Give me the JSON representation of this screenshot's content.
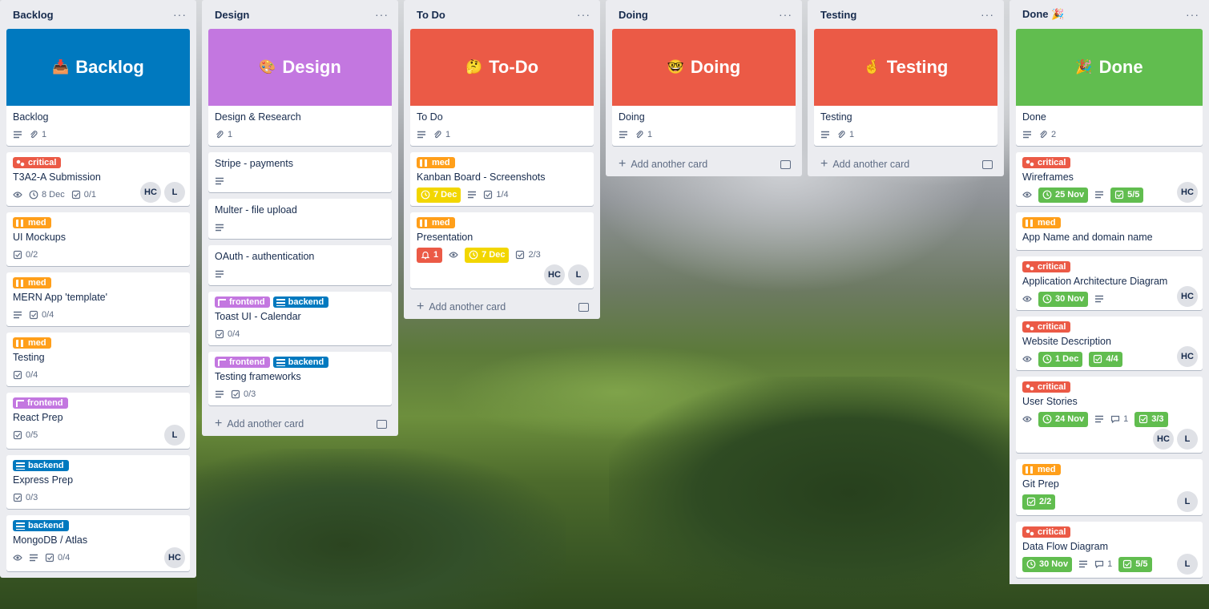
{
  "colors": {
    "list_bg": "#ebecf0",
    "critical": "#eb5a46",
    "med": "#ff9f1a",
    "frontend": "#c377e0",
    "backend": "#0079bf",
    "done_green": "#61bd4f",
    "due_yellow": "#f2d600"
  },
  "common": {
    "add_card": "Add another card",
    "menu": "···"
  },
  "lists": {
    "backlog": {
      "title": "Backlog",
      "cover": {
        "emoji": "📥",
        "text": "Backlog"
      },
      "cards": [
        {
          "title": "Backlog",
          "attachments": "1"
        },
        {
          "label": "critical",
          "title": "T3A2-A Submission",
          "due": "8 Dec",
          "checklist": "0/1",
          "members": [
            "HC",
            "L"
          ]
        },
        {
          "label": "med",
          "title": "UI Mockups",
          "checklist": "0/2"
        },
        {
          "label": "med",
          "title": "MERN App 'template'",
          "checklist": "0/4"
        },
        {
          "label": "med",
          "title": "Testing",
          "checklist": "0/4"
        },
        {
          "label": "frontend",
          "title": "React Prep",
          "checklist": "0/5",
          "members": [
            "L"
          ]
        },
        {
          "label": "backend",
          "title": "Express Prep",
          "checklist": "0/3"
        },
        {
          "label": "backend",
          "title": "MongoDB / Atlas",
          "checklist": "0/4",
          "members": [
            "HC"
          ]
        }
      ]
    },
    "design": {
      "title": "Design",
      "cover": {
        "emoji": "🎨",
        "text": "Design"
      },
      "cards": [
        {
          "title": "Design & Research",
          "attachments": "1"
        },
        {
          "title": "Stripe - payments"
        },
        {
          "title": "Multer - file upload"
        },
        {
          "title": "OAuth - authentication"
        },
        {
          "labels": [
            "frontend",
            "backend"
          ],
          "title": "Toast UI - Calendar",
          "checklist": "0/4"
        },
        {
          "labels": [
            "frontend",
            "backend"
          ],
          "title": "Testing frameworks",
          "checklist": "0/3"
        }
      ]
    },
    "todo": {
      "title": "To Do",
      "cover": {
        "emoji": "🤔",
        "text": "To-Do"
      },
      "cards": [
        {
          "title": "To Do",
          "attachments": "1"
        },
        {
          "label": "med",
          "title": "Kanban Board - Screenshots",
          "due": "7 Dec",
          "checklist": "1/4"
        },
        {
          "label": "med",
          "title": "Presentation",
          "notifications": "1",
          "due": "7 Dec",
          "checklist": "2/3",
          "members": [
            "HC",
            "L"
          ]
        }
      ]
    },
    "doing": {
      "title": "Doing",
      "cover": {
        "emoji": "🤓",
        "text": "Doing"
      },
      "cards": [
        {
          "title": "Doing",
          "attachments": "1"
        }
      ]
    },
    "testing": {
      "title": "Testing",
      "cover": {
        "emoji": "🤞",
        "text": "Testing"
      },
      "cards": [
        {
          "title": "Testing",
          "attachments": "1"
        }
      ]
    },
    "done": {
      "title": "Done 🎉",
      "cover": {
        "emoji": "🎉",
        "text": "Done"
      },
      "cards": [
        {
          "title": "Done",
          "attachments": "2"
        },
        {
          "label": "critical",
          "title": "Wireframes",
          "due": "25 Nov",
          "checklist": "5/5",
          "members": [
            "HC"
          ]
        },
        {
          "label": "med",
          "title": "App Name and domain name"
        },
        {
          "label": "critical",
          "title": "Application Architecture Diagram",
          "due": "30 Nov",
          "members": [
            "HC"
          ]
        },
        {
          "label": "critical",
          "title": "Website Description",
          "due": "1 Dec",
          "checklist": "4/4",
          "members": [
            "HC"
          ]
        },
        {
          "label": "critical",
          "title": "User Stories",
          "due": "24 Nov",
          "comments": "1",
          "checklist": "3/3",
          "members": [
            "HC",
            "L"
          ]
        },
        {
          "label": "med",
          "title": "Git Prep",
          "checklist": "2/2",
          "members": [
            "L"
          ]
        },
        {
          "label": "critical",
          "title": "Data Flow Diagram",
          "due": "30 Nov",
          "comments": "1",
          "checklist": "5/5",
          "members": [
            "L"
          ]
        }
      ]
    }
  }
}
